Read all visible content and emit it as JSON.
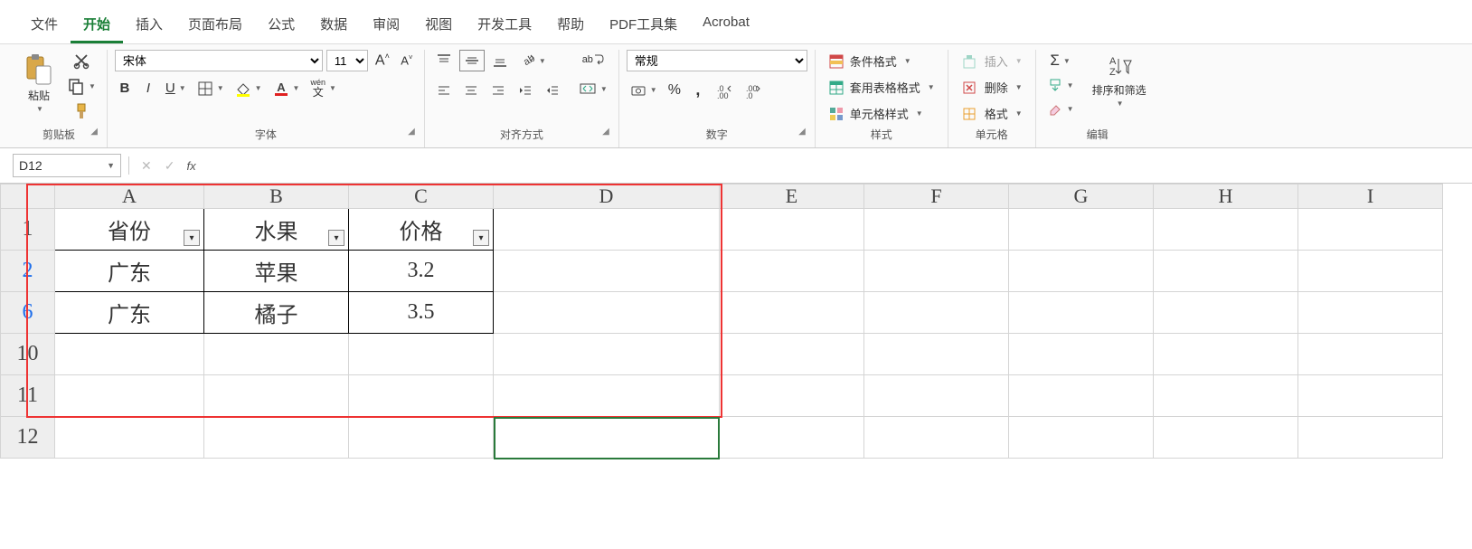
{
  "tabs": [
    "文件",
    "开始",
    "插入",
    "页面布局",
    "公式",
    "数据",
    "审阅",
    "视图",
    "开发工具",
    "帮助",
    "PDF工具集",
    "Acrobat"
  ],
  "active_tab": 1,
  "clipboard": {
    "paste": "粘贴",
    "label": "剪贴板"
  },
  "font": {
    "name": "宋体",
    "size": "11",
    "bold": "B",
    "italic": "I",
    "underline": "U",
    "ruby": "wén",
    "label": "字体"
  },
  "align": {
    "wrap": "ab",
    "label": "对齐方式"
  },
  "number": {
    "format": "常规",
    "label": "数字"
  },
  "styles": {
    "cond": "条件格式",
    "table": "套用表格格式",
    "cell": "单元格样式",
    "label": "样式"
  },
  "cells": {
    "insert": "插入",
    "delete": "删除",
    "format": "格式",
    "label": "单元格"
  },
  "editing": {
    "sort": "排序和筛选",
    "label": "编辑"
  },
  "namebox": "D12",
  "cols": [
    "A",
    "B",
    "C",
    "D",
    "E",
    "F",
    "G",
    "H",
    "I"
  ],
  "rows": [
    "1",
    "2",
    "6",
    "10",
    "11",
    "12"
  ],
  "filtered_rows": [
    1,
    2
  ],
  "data": {
    "A1": "省份",
    "B1": "水果",
    "C1": "价格",
    "A2": "广东",
    "B2": "苹果",
    "C2": "3.2",
    "A3": "广东",
    "B3": "橘子",
    "C3": "3.5"
  }
}
